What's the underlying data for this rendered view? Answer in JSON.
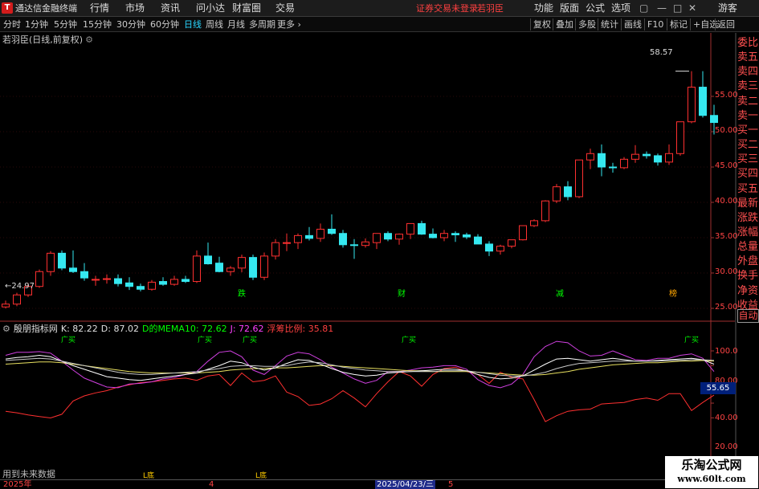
{
  "app": {
    "name": "通达信金融终端",
    "notice": "证券交易未登录",
    "account": "若羽臣",
    "guest": "游客"
  },
  "menus": [
    "行情",
    "市场",
    "资讯",
    "问小达",
    "财富圈",
    "交易"
  ],
  "right_menus": [
    "功能",
    "版面",
    "公式",
    "选项"
  ],
  "toolbar": {
    "periods": [
      "分时",
      "1分钟",
      "5分钟",
      "15分钟",
      "30分钟",
      "60分钟",
      "日线",
      "周线",
      "月线",
      "多周期",
      "更多"
    ],
    "active": "日线",
    "right": [
      "复权",
      "叠加",
      "多股",
      "统计",
      "画线",
      "F10",
      "标记",
      "+自选",
      "返回"
    ]
  },
  "chart": {
    "title": "若羽臣(日线,前复权)",
    "high_label": "58.57",
    "low_label": "24.97",
    "price_axis": [
      "55.00",
      "50.00",
      "45.00",
      "40.00",
      "35.00",
      "30.00",
      "25.00"
    ],
    "events": [
      {
        "text": "跌",
        "color": "green"
      },
      {
        "text": "财",
        "color": "green"
      },
      {
        "text": "减",
        "color": "green"
      },
      {
        "text": "榜",
        "color": "orange"
      }
    ]
  },
  "candles": [
    [
      25.2,
      26.1,
      24.97,
      25.6
    ],
    [
      25.6,
      27.2,
      25.3,
      26.9
    ],
    [
      26.9,
      28.6,
      26.6,
      28.1
    ],
    [
      28.1,
      30.5,
      27.9,
      30.2
    ],
    [
      30.2,
      33.1,
      29.6,
      32.8
    ],
    [
      32.8,
      33.2,
      30.4,
      30.7
    ],
    [
      30.7,
      33.2,
      30.0,
      30.2
    ],
    [
      30.2,
      31.4,
      28.9,
      29.3
    ],
    [
      29.0,
      29.6,
      28.2,
      29.1
    ],
    [
      29.1,
      29.8,
      28.5,
      29.2
    ],
    [
      29.2,
      29.8,
      28.1,
      28.5
    ],
    [
      28.6,
      29.4,
      27.6,
      28.1
    ],
    [
      28.1,
      28.5,
      27.4,
      27.7
    ],
    [
      27.7,
      29.0,
      27.5,
      28.7
    ],
    [
      28.8,
      29.4,
      28.2,
      28.4
    ],
    [
      28.4,
      29.6,
      28.2,
      29.1
    ],
    [
      29.1,
      29.6,
      28.6,
      28.8
    ],
    [
      28.8,
      33.2,
      28.6,
      32.4
    ],
    [
      32.4,
      34.3,
      31.2,
      31.3
    ],
    [
      31.4,
      32.3,
      30.1,
      30.2
    ],
    [
      30.2,
      31.0,
      29.6,
      30.7
    ],
    [
      30.7,
      32.6,
      30.1,
      32.2
    ],
    [
      32.2,
      32.6,
      29.0,
      29.4
    ],
    [
      29.4,
      32.9,
      29.0,
      32.4
    ],
    [
      32.4,
      34.8,
      31.9,
      34.3
    ],
    [
      34.3,
      35.6,
      33.1,
      34.3
    ],
    [
      34.3,
      35.6,
      33.4,
      35.3
    ],
    [
      35.3,
      36.5,
      34.6,
      34.9
    ],
    [
      34.9,
      37.0,
      34.4,
      36.2
    ],
    [
      36.2,
      38.3,
      35.4,
      35.6
    ],
    [
      35.6,
      36.1,
      33.6,
      34.0
    ],
    [
      34.0,
      34.8,
      32.0,
      33.9
    ],
    [
      33.9,
      34.9,
      33.6,
      34.4
    ],
    [
      34.3,
      35.6,
      33.4,
      35.6
    ],
    [
      35.6,
      35.9,
      34.5,
      34.8
    ],
    [
      34.8,
      35.6,
      34.0,
      35.5
    ],
    [
      35.5,
      37.0,
      34.8,
      37.0
    ],
    [
      37.0,
      37.4,
      35.4,
      35.5
    ],
    [
      35.5,
      36.3,
      34.9,
      35.0
    ],
    [
      35.0,
      36.1,
      34.5,
      35.6
    ],
    [
      35.6,
      35.9,
      34.4,
      35.4
    ],
    [
      35.4,
      35.7,
      34.8,
      35.1
    ],
    [
      35.1,
      35.5,
      34.2,
      34.1
    ],
    [
      34.1,
      34.5,
      32.4,
      33.1
    ],
    [
      33.1,
      34.0,
      32.6,
      33.8
    ],
    [
      33.8,
      34.6,
      33.5,
      34.7
    ],
    [
      34.7,
      36.7,
      34.6,
      36.7
    ],
    [
      36.7,
      37.6,
      36.5,
      37.4
    ],
    [
      37.4,
      40.3,
      37.2,
      40.2
    ],
    [
      40.2,
      42.6,
      39.9,
      42.2
    ],
    [
      42.2,
      43.0,
      40.3,
      40.8
    ],
    [
      40.8,
      46.0,
      40.6,
      46.0
    ],
    [
      46.0,
      47.6,
      44.7,
      46.9
    ],
    [
      46.9,
      48.2,
      43.7,
      45.0
    ],
    [
      45.0,
      45.6,
      44.2,
      44.9
    ],
    [
      44.9,
      46.4,
      44.7,
      46.1
    ],
    [
      46.1,
      48.1,
      45.6,
      46.8
    ],
    [
      46.8,
      47.2,
      46.2,
      46.6
    ],
    [
      46.6,
      46.9,
      45.2,
      45.7
    ],
    [
      45.7,
      48.2,
      45.3,
      46.9
    ],
    [
      46.9,
      51.4,
      46.6,
      51.4
    ],
    [
      51.4,
      58.57,
      51.2,
      56.3
    ],
    [
      56.3,
      58.57,
      52.0,
      52.3
    ],
    [
      52.3,
      53.8,
      49.6,
      51.3
    ]
  ],
  "candle_colors": {
    "up": "#ff3030",
    "down": "#35e8f0",
    "bg": "#000000"
  },
  "indicator": {
    "name": "殷朋指标网",
    "legend": [
      {
        "text": "K: 82.22",
        "color": "#e0e0e0"
      },
      {
        "text": "D: 87.02",
        "color": "#e0e0e0"
      },
      {
        "text": "D的MEMA10: 72.62",
        "color": "#00ff00"
      },
      {
        "text": "J: 72.62",
        "color": "#ff40ff"
      },
      {
        "text": "浮筹比例: 35.81",
        "color": "#ff4040"
      }
    ],
    "axis": [
      "100.0",
      "80.00",
      "40.00",
      "20.00"
    ],
    "current": "55.65",
    "signals_top": [
      "广买",
      "广买",
      "广买",
      "广买",
      "广买"
    ],
    "signals_bottom": [
      "L底",
      "L底"
    ],
    "future_note": "用到未来数据",
    "k": [
      89,
      91,
      92,
      94,
      92,
      86,
      80,
      75,
      70,
      65,
      63,
      61,
      60,
      62,
      64,
      66,
      68,
      70,
      75,
      80,
      86,
      84,
      78,
      74,
      77,
      83,
      88,
      87,
      82,
      76,
      71,
      68,
      66,
      67,
      70,
      71,
      72,
      73,
      74,
      75,
      75,
      73,
      68,
      64,
      62,
      63,
      66,
      74,
      82,
      89,
      90,
      88,
      86,
      88,
      90,
      88,
      86,
      86,
      87,
      88,
      89,
      90,
      88,
      82
    ],
    "d": [
      87,
      88,
      89,
      90,
      89,
      86,
      83,
      80,
      77,
      74,
      71,
      69,
      68,
      68,
      69,
      70,
      71,
      72,
      74,
      76,
      79,
      80,
      80,
      79,
      79,
      80,
      83,
      85,
      84,
      81,
      78,
      76,
      74,
      73,
      72,
      72,
      72,
      72,
      72,
      73,
      73,
      73,
      71,
      69,
      67,
      66,
      66,
      68,
      71,
      76,
      80,
      83,
      84,
      85,
      86,
      86,
      86,
      86,
      86,
      87,
      87,
      88,
      88,
      87
    ],
    "mema": [
      82,
      83,
      84,
      85,
      85,
      84,
      82,
      80,
      78,
      76,
      74,
      72,
      71,
      70,
      70,
      70,
      70,
      70,
      71,
      72,
      74,
      75,
      76,
      76,
      77,
      77,
      78,
      79,
      80,
      80,
      79,
      78,
      77,
      76,
      75,
      74,
      73,
      73,
      72,
      72,
      72,
      72,
      71,
      70,
      69,
      68,
      67,
      67,
      68,
      70,
      72,
      75,
      77,
      79,
      81,
      82,
      83,
      84,
      84,
      85,
      86,
      86,
      87,
      86
    ],
    "j": [
      94,
      98,
      98,
      99,
      97,
      86,
      74,
      63,
      57,
      51,
      50,
      55,
      56,
      58,
      62,
      64,
      68,
      72,
      86,
      98,
      100,
      92,
      74,
      68,
      80,
      93,
      98,
      96,
      88,
      78,
      70,
      62,
      56,
      60,
      72,
      72,
      74,
      77,
      78,
      80,
      80,
      75,
      61,
      53,
      50,
      55,
      68,
      92,
      106,
      113,
      111,
      100,
      93,
      94,
      100,
      94,
      88,
      87,
      90,
      90,
      94,
      96,
      90,
      72
    ],
    "float": [
      18,
      16,
      13,
      11,
      9,
      14,
      32,
      39,
      43,
      46,
      51,
      54,
      57,
      58,
      60,
      62,
      63,
      60,
      66,
      68,
      53,
      70,
      58,
      60,
      66,
      44,
      38,
      26,
      28,
      35,
      46,
      36,
      24,
      42,
      58,
      72,
      66,
      52,
      68,
      76,
      78,
      72,
      68,
      56,
      71,
      64,
      62,
      34,
      4,
      12,
      18,
      20,
      21,
      28,
      29,
      30,
      34,
      36,
      33,
      42,
      42,
      19,
      30,
      40
    ]
  },
  "right_col": [
    "委比",
    "卖五",
    "卖四",
    "卖三",
    "卖二",
    "卖一",
    "买一",
    "买二",
    "买三",
    "买四",
    "买五",
    "最新",
    "涨跌",
    "涨幅",
    "总量",
    "外盘",
    "换手",
    "净资",
    "收益"
  ],
  "auto_btn": "自动",
  "dates": [
    {
      "text": "2025年",
      "cur": false
    },
    {
      "text": "4",
      "cur": false
    },
    {
      "text": "2025/04/23/三",
      "cur": true
    },
    {
      "text": "5",
      "cur": false
    }
  ],
  "watermark": {
    "line1": "乐淘公式网",
    "line2": "www.60lt.com"
  }
}
